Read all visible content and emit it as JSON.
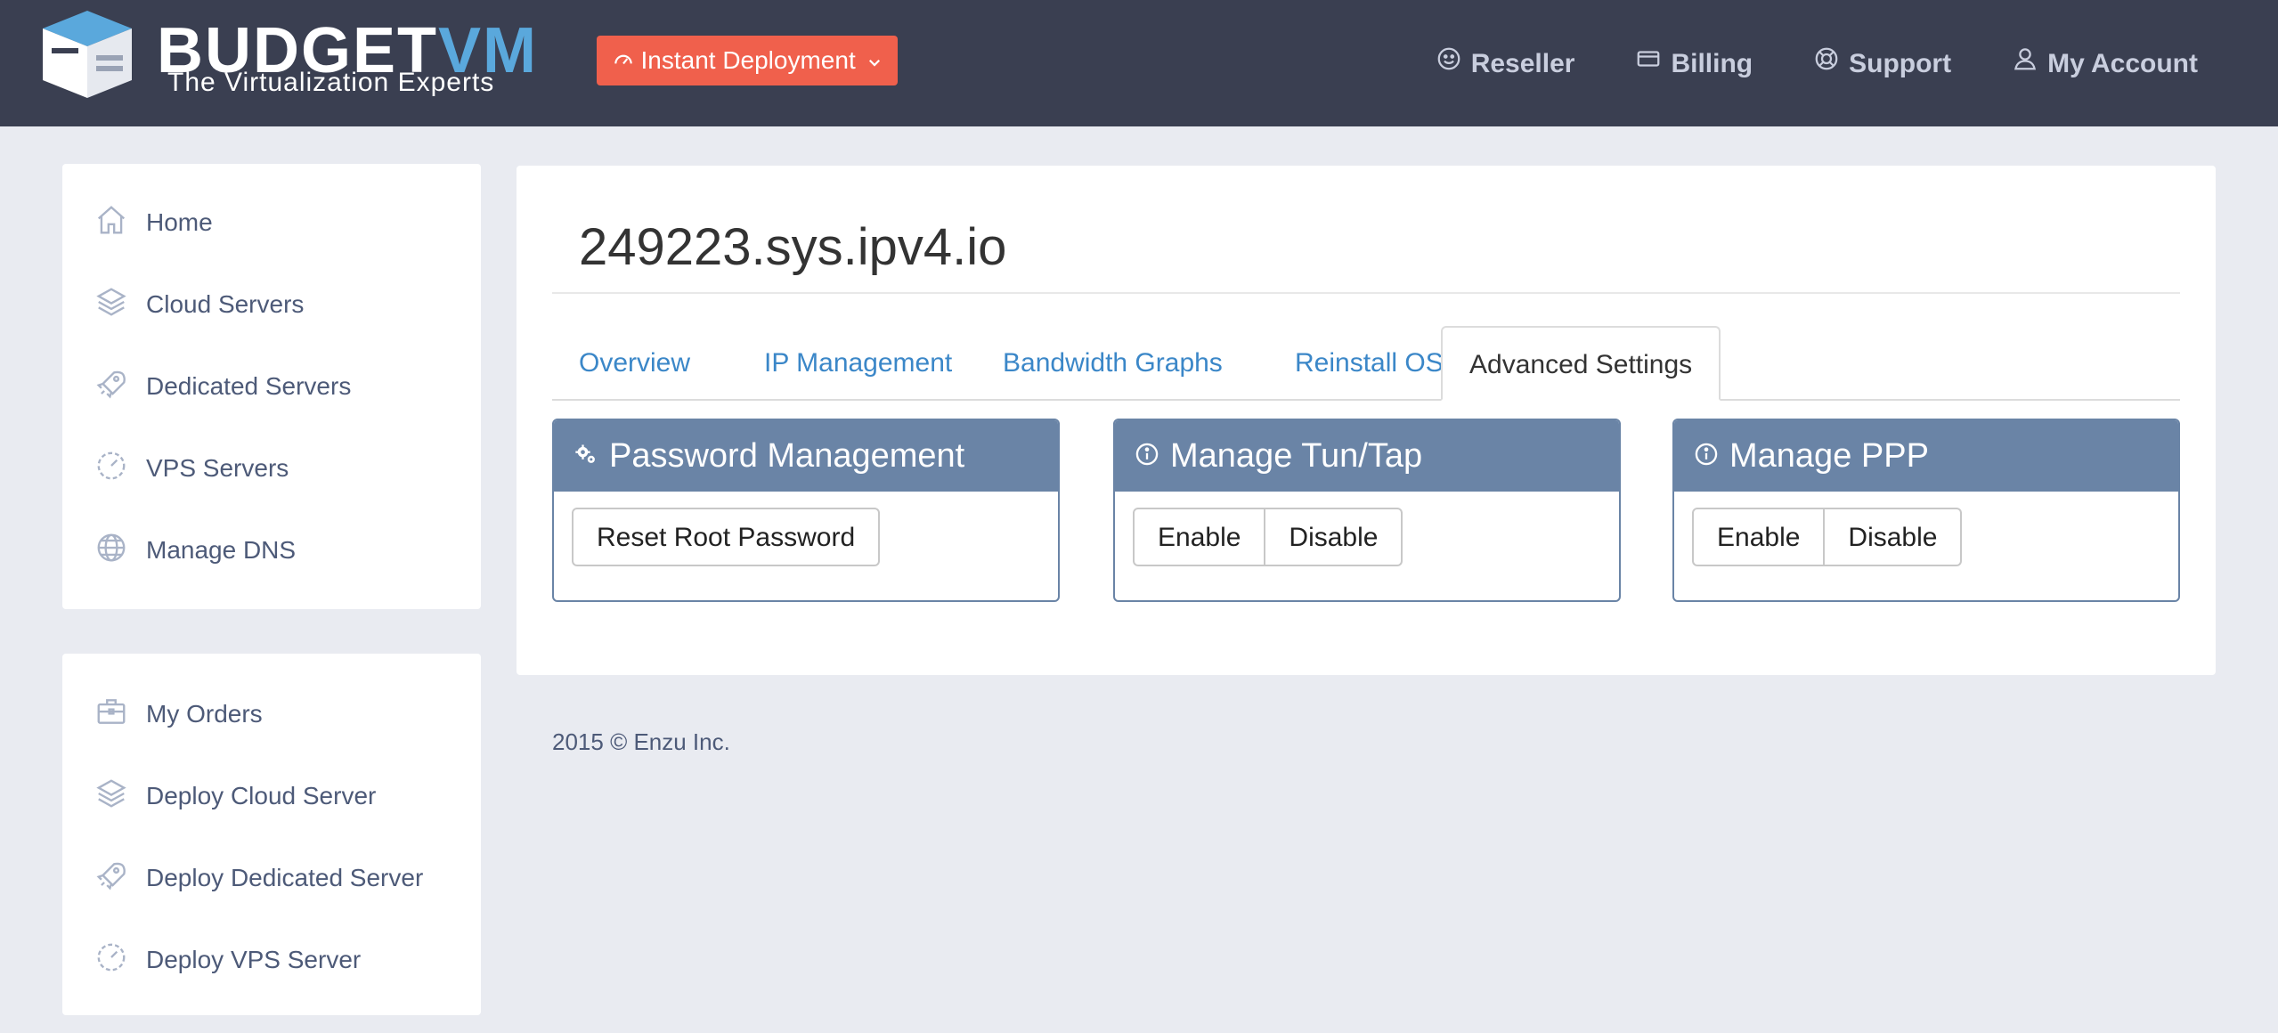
{
  "header": {
    "brand_main": "BUDGET",
    "brand_accent": "VM",
    "tagline": "The Virtualization Experts",
    "deploy_label": "Instant Deployment",
    "nav": [
      {
        "label": "Reseller",
        "icon": "smile-icon"
      },
      {
        "label": "Billing",
        "icon": "credit-card-icon"
      },
      {
        "label": "Support",
        "icon": "lifebuoy-icon"
      },
      {
        "label": "My Account",
        "icon": "user-icon"
      }
    ]
  },
  "sidebar": {
    "primary": [
      {
        "label": "Home",
        "icon": "home-icon"
      },
      {
        "label": "Cloud Servers",
        "icon": "layers-icon"
      },
      {
        "label": "Dedicated Servers",
        "icon": "rocket-icon"
      },
      {
        "label": "VPS Servers",
        "icon": "speedometer-icon"
      },
      {
        "label": "Manage DNS",
        "icon": "globe-icon"
      }
    ],
    "secondary": [
      {
        "label": "My Orders",
        "icon": "briefcase-icon"
      },
      {
        "label": "Deploy Cloud Server",
        "icon": "layers-icon"
      },
      {
        "label": "Deploy Dedicated Server",
        "icon": "rocket-icon"
      },
      {
        "label": "Deploy VPS Server",
        "icon": "speedometer-icon"
      }
    ]
  },
  "main": {
    "hostname": "249223.sys.ipv4.io",
    "tabs": [
      "Overview",
      "IP Management",
      "Bandwidth Graphs",
      "Reinstall OS",
      "Advanced Settings"
    ],
    "active_tab": "Advanced Settings",
    "panels": {
      "password": {
        "title": "Password Management",
        "button": "Reset Root Password"
      },
      "tuntap": {
        "title": "Manage Tun/Tap",
        "enable": "Enable",
        "disable": "Disable"
      },
      "ppp": {
        "title": "Manage PPP",
        "enable": "Enable",
        "disable": "Disable"
      }
    }
  },
  "footer": {
    "text": "2015 © Enzu Inc."
  },
  "colors": {
    "topbar": "#3a3f51",
    "accent_red": "#f0604c",
    "panel_header": "#6a84a6",
    "link_blue": "#3b87c8"
  }
}
